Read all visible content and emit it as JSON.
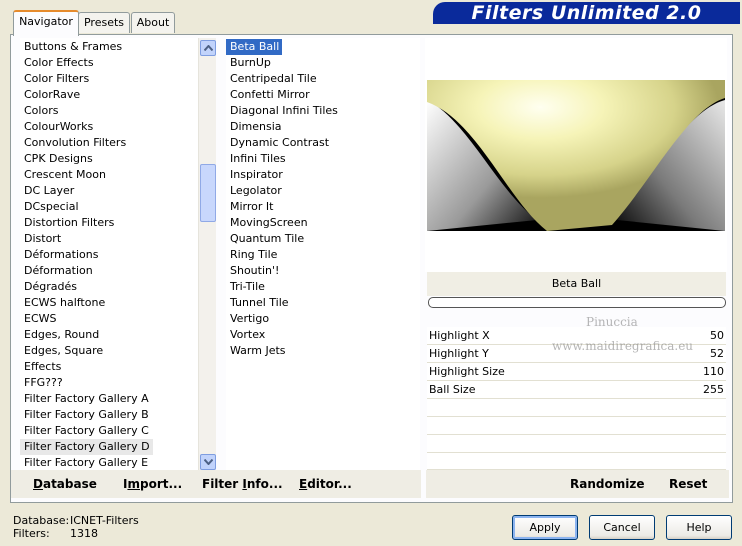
{
  "tabs": [
    {
      "label": "Navigator"
    },
    {
      "label": "Presets"
    },
    {
      "label": "About"
    }
  ],
  "banner": "Filters Unlimited 2.0",
  "categories": [
    "Buttons & Frames",
    "Color Effects",
    "Color Filters",
    "ColorRave",
    "Colors",
    "ColourWorks",
    "Convolution Filters",
    "CPK Designs",
    "Crescent Moon",
    "DC Layer",
    "DCspecial",
    "Distortion Filters",
    "Distort",
    "Déformations",
    "Déformation",
    "Dégradés",
    "ECWS halftone",
    "ECWS",
    "Edges, Round",
    "Edges, Square",
    "Effects",
    "FFG???",
    "Filter Factory Gallery A",
    "Filter Factory Gallery B",
    "Filter Factory Gallery C",
    "Filter Factory Gallery D",
    "Filter Factory Gallery E"
  ],
  "selected_category": "Filter Factory Gallery D",
  "filters": [
    "Beta Ball",
    "BurnUp",
    "Centripedal Tile",
    "Confetti Mirror",
    "Diagonal Infini Tiles",
    "Dimensia",
    "Dynamic Contrast",
    "Infini Tiles",
    "Inspirator",
    "Legolator",
    "Mirror It",
    "MovingScreen",
    "Quantum Tile",
    "Ring Tile",
    "Shoutin'!",
    "Tri-Tile",
    "Tunnel Tile",
    "Vertigo",
    "Vortex",
    "Warm Jets"
  ],
  "selected_filter": "Beta Ball",
  "filter_title": "Beta Ball",
  "watermark": {
    "line1": "Pinuccia",
    "line2": "www.maidiregrafica.eu"
  },
  "params": [
    {
      "label": "Highlight X",
      "value": "50"
    },
    {
      "label": "Highlight Y",
      "value": "52"
    },
    {
      "label": "Highlight Size",
      "value": "110"
    },
    {
      "label": "Ball Size",
      "value": "255"
    }
  ],
  "buttons": {
    "database": {
      "underline": "D",
      "rest": "atabase"
    },
    "import": {
      "pre": "I",
      "underline": "m",
      "rest": "port..."
    },
    "filter_info": {
      "pre": "Filter ",
      "underline": "I",
      "rest": "nfo..."
    },
    "editor": {
      "underline": "E",
      "rest": "ditor..."
    },
    "randomize": "Randomize",
    "reset": "Reset",
    "apply": "Apply",
    "cancel": "Cancel",
    "help": "Help"
  },
  "status": {
    "database_label": "Database:",
    "database_value": "ICNET-Filters",
    "filters_label": "Filters:",
    "filters_value": "1318"
  },
  "colors": {
    "selection": "#316AC5",
    "banner": "#0A2A9B",
    "tab_highlight": "#E68B2C"
  }
}
